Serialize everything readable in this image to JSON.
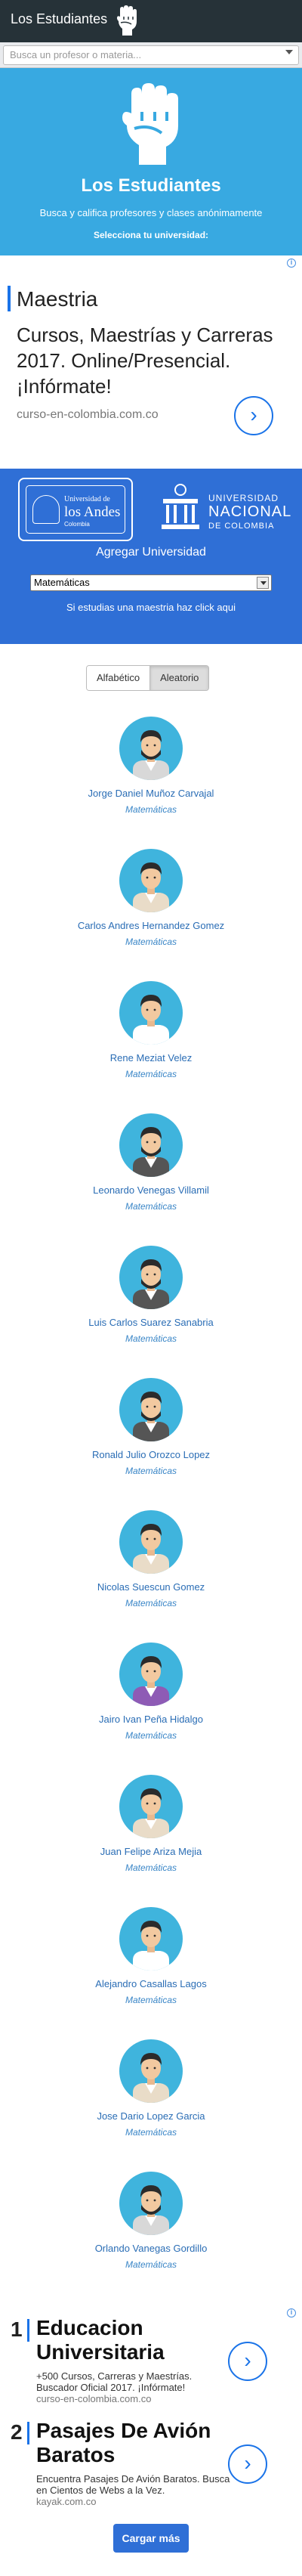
{
  "navbar": {
    "brand": "Los Estudiantes"
  },
  "search": {
    "placeholder": "Busca un profesor o materia..."
  },
  "hero": {
    "title": "Los Estudiantes",
    "subtitle": "Busca y califica profesores y clases anónimamente",
    "select_prompt": "Selecciona tu universidad:"
  },
  "ad_top": {
    "title": "Maestria",
    "body": "Cursos, Maestrías y Carreras 2017. Online/Presencial. ¡Infórmate!",
    "url": "curso-en-colombia.com.co",
    "arrow": "›",
    "info": "i"
  },
  "universities": {
    "andes": {
      "line1": "Universidad de",
      "line2": "los Andes",
      "line3": "Colombia"
    },
    "nacional": {
      "line1": "UNIVERSIDAD",
      "line2": "NACIONAL",
      "line3": "DE COLOMBIA"
    },
    "add_label": "Agregar Universidad",
    "department_selected": "Matemáticas",
    "masters_link": "Si estudias una maestria haz click aqui"
  },
  "sort_toggle": {
    "alphabetic": "Alfabético",
    "random": "Aleatorio"
  },
  "professors": [
    {
      "name": "Jorge Daniel Muñoz Carvajal",
      "subject": "Matemáticas",
      "hair": "#2b2b2b",
      "beard": true,
      "shirt": "#ffffff",
      "jacket": "#d8d8d8"
    },
    {
      "name": "Carlos Andres Hernandez Gomez",
      "subject": "Matemáticas",
      "hair": "#2b2b2b",
      "beard": false,
      "shirt": "#ffffff",
      "jacket": "#e9dcc8"
    },
    {
      "name": "Rene Meziat Velez",
      "subject": "Matemáticas",
      "hair": "#2b2b2b",
      "beard": false,
      "shirt": "#ffffff",
      "jacket": "#ffffff"
    },
    {
      "name": "Leonardo Venegas Villamil",
      "subject": "Matemáticas",
      "hair": "#2b2b2b",
      "beard": true,
      "shirt": "#ffffff",
      "jacket": "#555555"
    },
    {
      "name": "Luis Carlos Suarez Sanabria",
      "subject": "Matemáticas",
      "hair": "#2b2b2b",
      "beard": true,
      "shirt": "#ffffff",
      "jacket": "#555555"
    },
    {
      "name": "Ronald Julio Orozco Lopez",
      "subject": "Matemáticas",
      "hair": "#2b2b2b",
      "beard": true,
      "shirt": "#ffffff",
      "jacket": "#555555"
    },
    {
      "name": "Nicolas Suescun Gomez",
      "subject": "Matemáticas",
      "hair": "#2b2b2b",
      "beard": false,
      "shirt": "#ffffff",
      "jacket": "#e9dcc8"
    },
    {
      "name": "Jairo Ivan Peña Hidalgo",
      "subject": "Matemáticas",
      "hair": "#2b2b2b",
      "beard": false,
      "shirt": "#ffffff",
      "jacket": "#8e5bb5"
    },
    {
      "name": "Juan Felipe Ariza Mejia",
      "subject": "Matemáticas",
      "hair": "#2b2b2b",
      "beard": false,
      "shirt": "#ffffff",
      "jacket": "#e9dcc8"
    },
    {
      "name": "Alejandro Casallas Lagos",
      "subject": "Matemáticas",
      "hair": "#2b2b2b",
      "beard": false,
      "shirt": "#ffffff",
      "jacket": "#ffffff"
    },
    {
      "name": "Jose Dario Lopez Garcia",
      "subject": "Matemáticas",
      "hair": "#2b2b2b",
      "beard": false,
      "shirt": "#ffffff",
      "jacket": "#e9dcc8"
    },
    {
      "name": "Orlando Vanegas Gordillo",
      "subject": "Matemáticas",
      "hair": "#2b2b2b",
      "beard": true,
      "shirt": "#ffffff",
      "jacket": "#d8d8d8"
    }
  ],
  "ad_bottom": {
    "info": "i",
    "items": [
      {
        "num": "1",
        "title": "Educacion Universitaria",
        "desc": "+500 Cursos, Carreras y Maestrías. Buscador Oficial 2017. ¡Infórmate!",
        "url": "curso-en-colombia.com.co",
        "arrow": "›"
      },
      {
        "num": "2",
        "title": "Pasajes De Avión Baratos",
        "desc": "Encuentra Pasajes De Avión Baratos. Busca en Cientos de Webs a la Vez.",
        "url": "kayak.com.co",
        "arrow": "›"
      }
    ]
  },
  "load_more": "Cargar más",
  "colors": {
    "navbar": "#263238",
    "hero": "#38a9e1",
    "uni_panel": "#2f6fd6",
    "link": "#2a6db5",
    "avatar_bg": "#3fb4dd"
  }
}
